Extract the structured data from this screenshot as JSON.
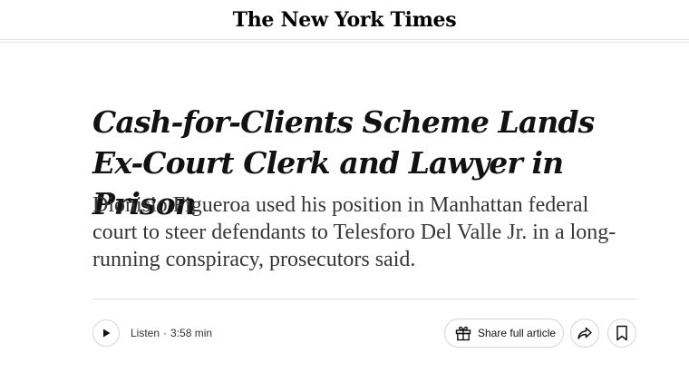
{
  "masthead": {
    "logo_text": "The New York Times"
  },
  "article": {
    "headline": "Cash-for-Clients Scheme Lands Ex-Court Clerk and Lawyer in Prison",
    "summary": "Dionisio Figueroa used his position in Manhattan federal court to steer defendants to Telesforo Del Valle Jr. in a long-running conspiracy, prosecutors said."
  },
  "toolbar": {
    "listen_label": "Listen",
    "separator": "·",
    "listen_duration": "3:58 min",
    "share_label": "Share full article"
  },
  "icons": {
    "play": "play-icon",
    "gift": "gift-icon",
    "forward": "forward-arrow-icon",
    "bookmark": "bookmark-icon"
  },
  "colors": {
    "text": "#121212",
    "summary_text": "#363636",
    "border": "#d6d6d6"
  }
}
